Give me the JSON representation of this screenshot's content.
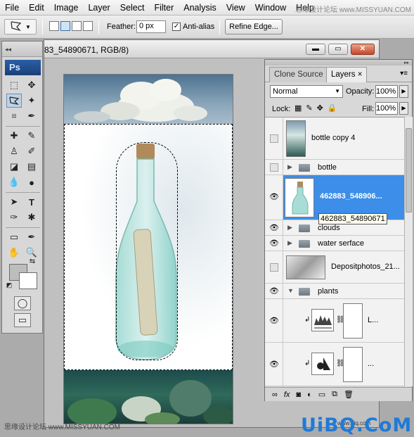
{
  "menu": [
    "File",
    "Edit",
    "Image",
    "Layer",
    "Select",
    "Filter",
    "Analysis",
    "View",
    "Window",
    "Help"
  ],
  "watermark_top": "思缘设计论坛 www.MISSYUAN.COM",
  "options_bar": {
    "feather_label": "Feather:",
    "feather_value": "0 px",
    "antialias_label": "Anti-alias",
    "antialias_checked": "✓",
    "refine_edge_label": "Refine Edge..."
  },
  "document": {
    "title": "83_54890671, RGB/8)",
    "minimize": "▬",
    "maximize": "▭",
    "close": "✕"
  },
  "toolbox": {
    "head": "◂◂",
    "logo": "Ps"
  },
  "layers_panel": {
    "tab_clone": "Clone Source",
    "tab_layers": "Layers",
    "tab_close": "×",
    "blend_mode": "Normal",
    "opacity_label": "Opacity:",
    "opacity_value": "100%",
    "lock_label": "Lock:",
    "fill_label": "Fill:",
    "fill_value": "100%",
    "layers": [
      {
        "name": "bottle copy 4",
        "visible": false,
        "kind": "layer"
      },
      {
        "name": "bottle",
        "visible": false,
        "kind": "group"
      },
      {
        "name": "462883_548906...",
        "visible": true,
        "kind": "layer",
        "selected": true
      },
      {
        "name": "clouds",
        "visible": true,
        "kind": "group"
      },
      {
        "name": "water serface",
        "visible": true,
        "kind": "group"
      },
      {
        "name": "Depositphotos_21...",
        "visible": false,
        "kind": "layer"
      },
      {
        "name": "plants",
        "visible": true,
        "kind": "group",
        "expanded": true
      },
      {
        "name": "L...",
        "visible": true,
        "kind": "adjustment"
      },
      {
        "name": "...",
        "visible": true,
        "kind": "adjustment"
      }
    ],
    "tooltip": "462883_54890671",
    "bottom_icons": [
      "link-icon",
      "fx-icon",
      "mask-icon",
      "adjustment-icon",
      "group-icon",
      "new-layer-icon",
      "trash-icon"
    ]
  },
  "watermarks": {
    "left": "思缘设计论坛 www.MISSYUAN.COM",
    "mid": "www.uiq.com",
    "right": "UiBQ.CoM"
  }
}
